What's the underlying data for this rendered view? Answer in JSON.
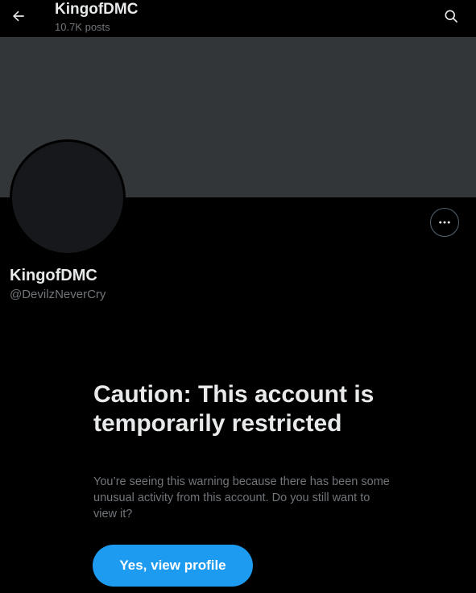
{
  "header": {
    "title": "KingofDMC",
    "subtitle": "10.7K posts",
    "back_icon": "arrow-left-icon",
    "search_icon": "search-icon"
  },
  "profile": {
    "display_name": "KingofDMC",
    "handle": "@DevilzNeverCry",
    "more_icon": "ellipsis-icon"
  },
  "warning": {
    "title": "Caution: This account is temporarily restricted",
    "body": "You’re seeing this warning because there has been some unusual activity from this account. Do you still want to view it?",
    "button_label": "Yes, view profile"
  },
  "colors": {
    "background": "#000000",
    "banner": "#333639",
    "accent": "#1d9bf0",
    "text_primary": "#e7e9ea",
    "text_secondary": "#71767b"
  }
}
